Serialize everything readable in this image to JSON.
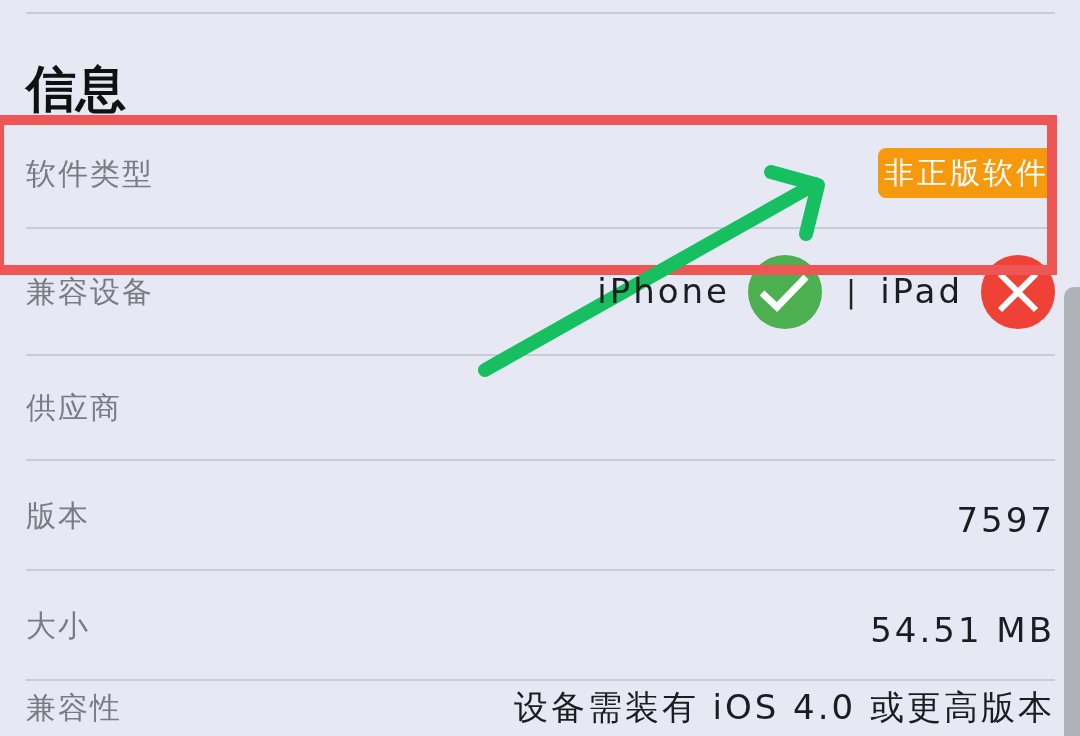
{
  "section_title": "信息",
  "rows": [
    {
      "label": "软件类型",
      "kind": "badge",
      "value": "非正版软件"
    },
    {
      "label": "兼容设备",
      "kind": "devices",
      "devices": [
        {
          "name": "iPhone",
          "supported": true
        },
        {
          "name": "iPad",
          "supported": false
        }
      ],
      "separator": "|"
    },
    {
      "label": "供应商",
      "kind": "text"
    },
    {
      "label": "版本",
      "kind": "text",
      "value": "7597"
    },
    {
      "label": "大小",
      "kind": "text",
      "value": "54.51 MB"
    },
    {
      "label": "兼容性",
      "kind": "text",
      "value": "设备需装有 iOS 4.0 或更高版本"
    }
  ]
}
